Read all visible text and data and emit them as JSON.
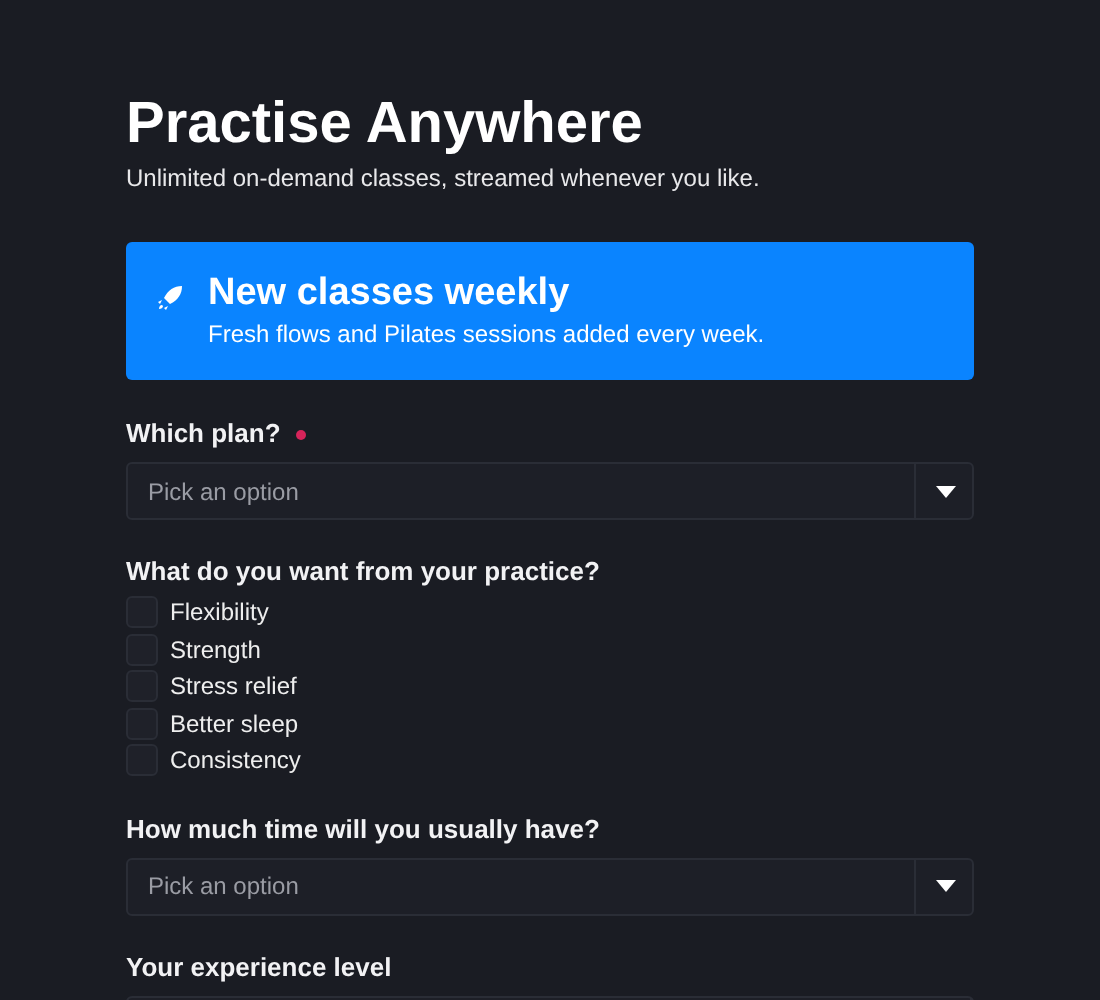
{
  "header": {
    "title": "Practise Anywhere",
    "subtitle": "Unlimited on-demand classes, streamed whenever you like."
  },
  "banner": {
    "title": "New classes weekly",
    "text": "Fresh flows and Pilates sessions added every week."
  },
  "fields": [
    {
      "kind": "select",
      "label": "Which plan?",
      "required": true,
      "placeholder": "Pick an option"
    },
    {
      "kind": "checkboxes",
      "label": "What do you want from your practice?",
      "required": false,
      "options": [
        {
          "label": "Flexibility",
          "checked": false
        },
        {
          "label": "Strength",
          "checked": false
        },
        {
          "label": "Stress relief",
          "checked": false
        },
        {
          "label": "Better sleep",
          "checked": false
        },
        {
          "label": "Consistency",
          "checked": false
        }
      ]
    },
    {
      "kind": "select",
      "label": "How much time will you usually have?",
      "required": false,
      "placeholder": "Pick an option"
    },
    {
      "kind": "select",
      "label": "Your experience level",
      "required": false
    }
  ]
}
